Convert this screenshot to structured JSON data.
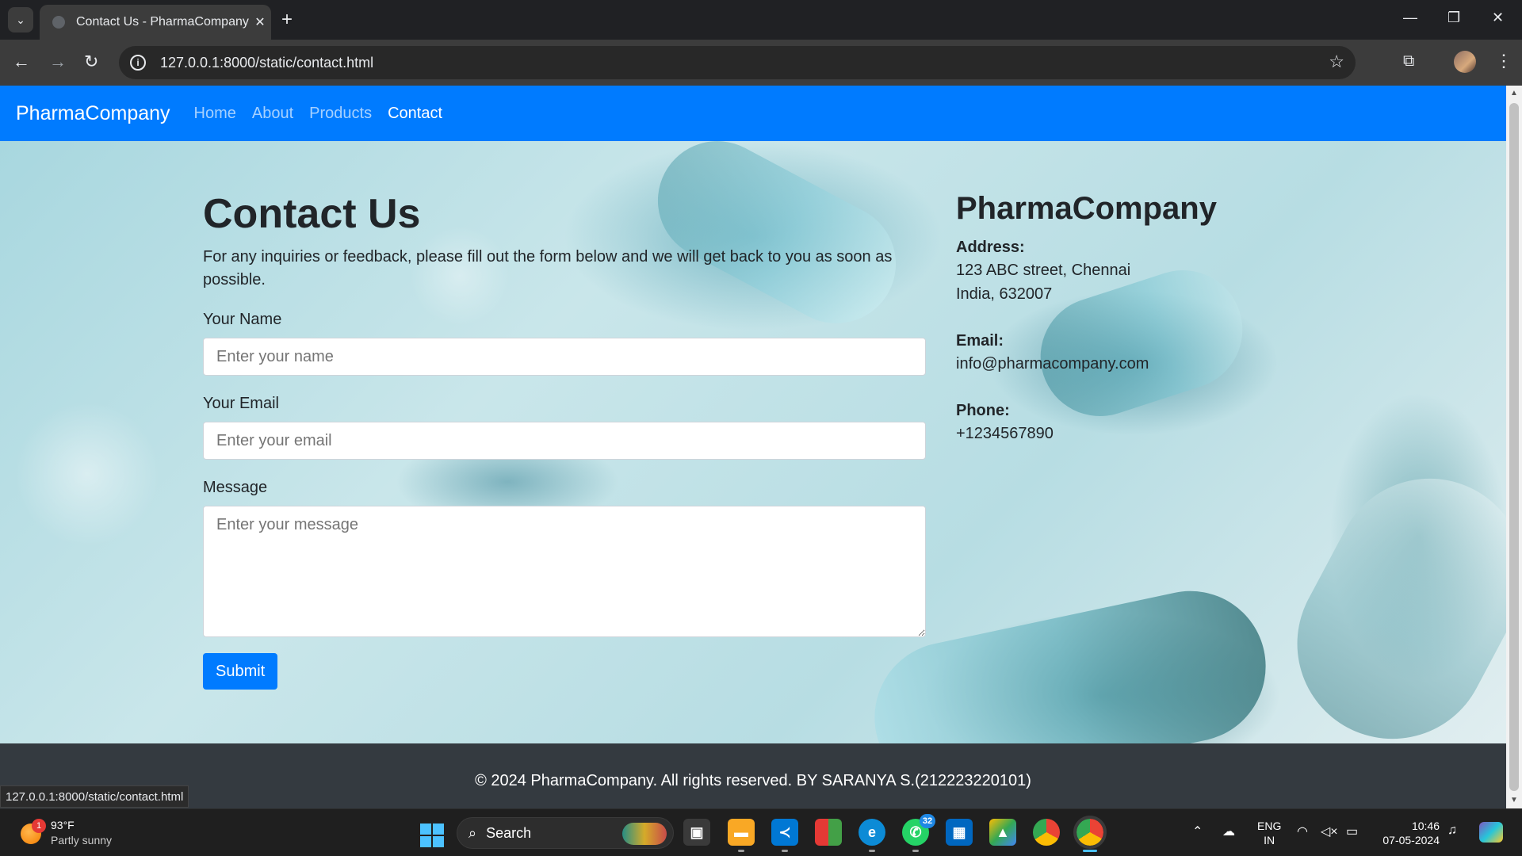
{
  "browser": {
    "tab_title": "Contact Us - PharmaCompany",
    "url": "127.0.0.1:8000/static/contact.html",
    "status_url": "127.0.0.1:8000/static/contact.html"
  },
  "nav": {
    "brand": "PharmaCompany",
    "links": [
      "Home",
      "About",
      "Products",
      "Contact"
    ],
    "active": "Contact"
  },
  "form": {
    "title": "Contact Us",
    "intro": "For any inquiries or feedback, please fill out the form below and we will get back to you as soon as possible.",
    "name_label": "Your Name",
    "name_placeholder": "Enter your name",
    "email_label": "Your Email",
    "email_placeholder": "Enter your email",
    "message_label": "Message",
    "message_placeholder": "Enter your message",
    "submit_label": "Submit"
  },
  "contact_info": {
    "title": "PharmaCompany",
    "address_label": "Address:",
    "address_line1": "123 ABC street, Chennai",
    "address_line2": "India, 632007",
    "email_label": "Email:",
    "email": "info@pharmacompany.com",
    "phone_label": "Phone:",
    "phone": "+1234567890"
  },
  "footer": {
    "text": "© 2024 PharmaCompany. All rights reserved. BY SARANYA S.(212223220101)"
  },
  "taskbar": {
    "weather_temp": "93°F",
    "weather_condition": "Partly sunny",
    "weather_badge": "1",
    "search_label": "Search",
    "whatsapp_badge": "32",
    "lang_line1": "ENG",
    "lang_line2": "IN",
    "time": "10:46",
    "date": "07-05-2024"
  },
  "colors": {
    "navbar": "#007bff",
    "footer": "#343a40",
    "button": "#007bff"
  }
}
